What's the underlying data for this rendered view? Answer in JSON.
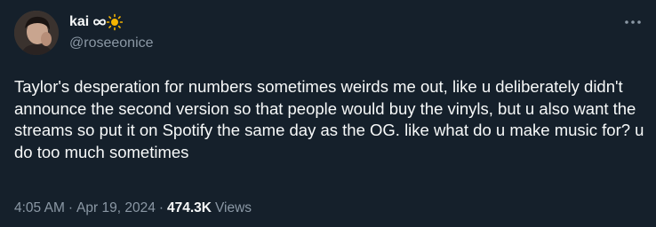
{
  "author": {
    "display_name": "kai",
    "name_emoji": "∞☀️",
    "handle": "@roseeonice"
  },
  "icons": {
    "more": "more-horizontal-icon",
    "infinity": "infinity-icon",
    "sun": "sun-icon"
  },
  "tweet": {
    "text": "Taylor's desperation for numbers sometimes weirds me out, like u deliberately didn't announce the second version so that people would buy the vinyls, but u also want the streams so put it on Spotify the same day as the OG. like what do u make music for? u do too much sometimes",
    "time": "4:05 AM",
    "date": "Apr 19, 2024",
    "views_count": "474.3K",
    "views_label": "Views",
    "separator": "·"
  },
  "colors": {
    "background": "#15202b",
    "text_primary": "#f7f9f9",
    "text_secondary": "#8b98a5",
    "sun": "#f5b400"
  }
}
